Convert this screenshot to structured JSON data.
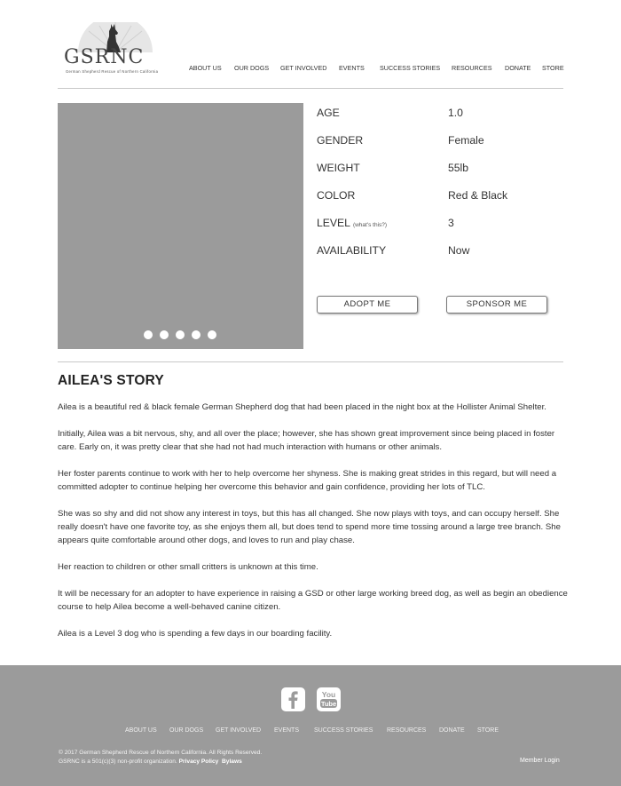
{
  "logo": {
    "text": "GSRNC",
    "subtitle": "German Shepherd Rescue of Northern California",
    "icon": "german-shepherd-silhouette"
  },
  "nav": {
    "items": [
      "ABOUT US",
      "OUR DOGS",
      "GET INVOLVED",
      "EVENTS",
      "SUCCESS STORIES",
      "RESOURCES",
      "DONATE",
      "STORE"
    ]
  },
  "profile": {
    "carousel_dots": 5,
    "facts": [
      {
        "label": "AGE",
        "note": "",
        "value": "1.0"
      },
      {
        "label": "GENDER",
        "note": "",
        "value": "Female"
      },
      {
        "label": "WEIGHT",
        "note": "",
        "value": "55lb"
      },
      {
        "label": "COLOR",
        "note": "",
        "value": "Red & Black"
      },
      {
        "label": "LEVEL",
        "note": "(what's this?)",
        "value": "3"
      },
      {
        "label": "AVAILABILITY",
        "note": "",
        "value": "Now"
      }
    ],
    "adopt_label": "ADOPT ME",
    "sponsor_label": "SPONSOR ME"
  },
  "story": {
    "title": "AILEA'S STORY",
    "paragraphs": [
      "Ailea is a beautiful red & black female German Shepherd dog that had been placed in the night box at the Hollister Animal Shelter.",
      "Initially, Ailea was a bit nervous, shy, and all over the place; however, she has shown great improvement since being placed in foster care. Early on, it was pretty clear that she had not had much interaction with humans or other animals.",
      "Her foster parents continue to work with her to help overcome her shyness. She is making great strides in this regard, but will need a committed adopter to continue helping her overcome this behavior and gain confidence, providing her lots of TLC.",
      "She was so shy and did not show any interest in toys, but this has all changed. She now plays with toys, and can occupy herself. She really doesn't have one favorite toy, as she enjoys them all, but does tend to spend more time tossing around a large tree branch. She appears quite comfortable around other dogs, and loves to run and play chase.",
      "Her reaction to children or other small critters is unknown at this time.",
      "It will be necessary for an adopter to have experience in raising a GSD or other large working breed dog, as well as begin an obedience course to help Ailea become a well-behaved canine citizen.",
      "Ailea is a Level 3 dog who is spending a few days in our boarding facility."
    ]
  },
  "footer": {
    "social": [
      {
        "icon": "facebook-icon",
        "label": "f"
      },
      {
        "icon": "youtube-icon",
        "label_top": "You",
        "label_bottom": "Tube"
      }
    ],
    "nav": [
      "ABOUT US",
      "OUR DOGS",
      "GET INVOLVED",
      "EVENTS",
      "SUCCESS STORIES",
      "RESOURCES",
      "DONATE",
      "STORE"
    ],
    "copyright_line1": "©  2017 German Shepherd Rescue of Northern California. All Rights Reserved.",
    "copyright_line2": "GSRNC is a 501(c)(3) non-profit organization.",
    "privacy_label": "Privacy Policy",
    "bylaws_label": "Bylaws",
    "member_login": "Member Login"
  },
  "colors": {
    "placeholder_gray": "#9b9b9b",
    "rule": "#c8c8c8",
    "text": "#333333"
  }
}
